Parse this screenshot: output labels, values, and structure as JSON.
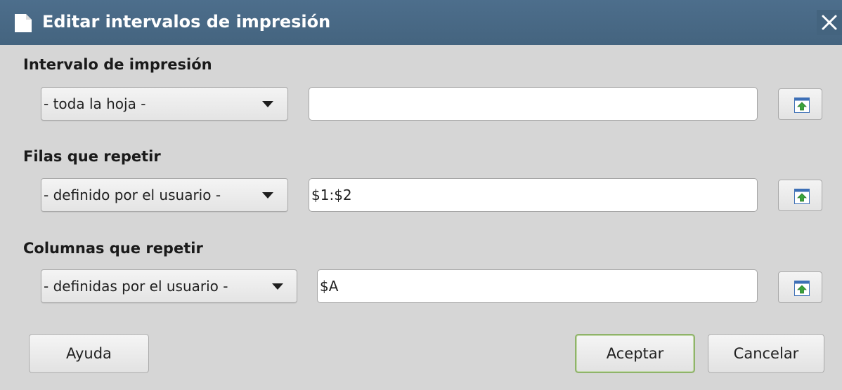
{
  "window": {
    "title": "Editar intervalos de impresión",
    "title_icon": "document-icon",
    "close_icon": "close-icon"
  },
  "print_range": {
    "label": "Intervalo de impresión",
    "dropdown_value": "- toda la hoja -",
    "field_value": "",
    "shrink_icon": "shrink-dialog-icon"
  },
  "rows_to_repeat": {
    "label": "Filas que repetir",
    "dropdown_value": "- definido por el usuario -",
    "field_value": "$1:$2",
    "shrink_icon": "shrink-dialog-icon"
  },
  "columns_to_repeat": {
    "label": "Columnas que repetir",
    "dropdown_value": "- definidas por el usuario -",
    "field_value": "$A",
    "shrink_icon": "shrink-dialog-icon"
  },
  "buttons": {
    "help": "Ayuda",
    "ok": "Aceptar",
    "cancel": "Cancelar"
  },
  "colors": {
    "titlebar": "#4d6e8c",
    "dialog_background": "#d6d6d6",
    "default_button_border": "#8fb36a"
  }
}
